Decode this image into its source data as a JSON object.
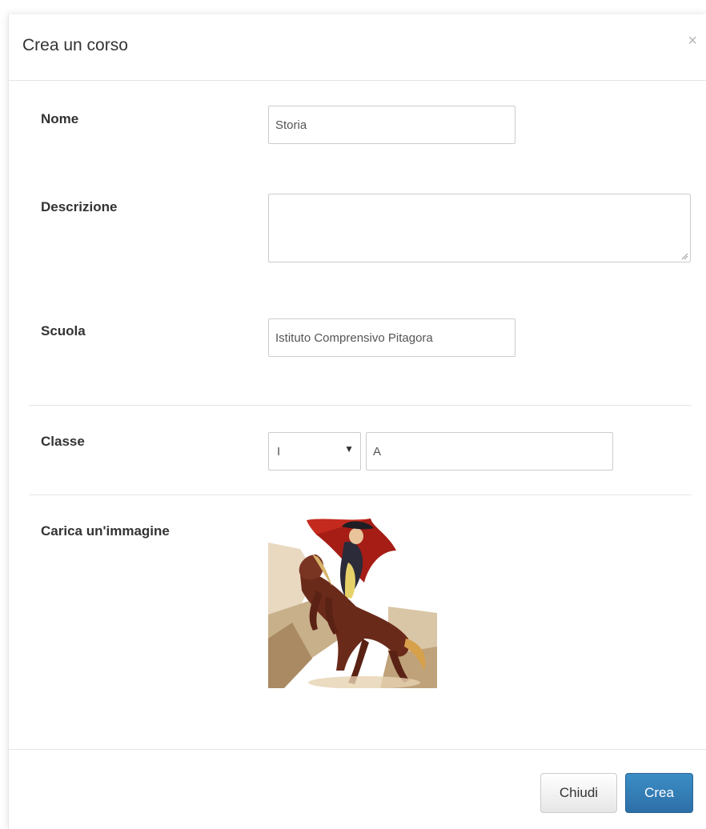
{
  "modal": {
    "title": "Crea un corso",
    "close_symbol": "×"
  },
  "form": {
    "nome": {
      "label": "Nome",
      "value": "Storia"
    },
    "descrizione": {
      "label": "Descrizione",
      "value": ""
    },
    "scuola": {
      "label": "Scuola",
      "value": "Istituto Comprensivo Pitagora"
    },
    "classe": {
      "label": "Classe",
      "select_value": "I",
      "section_value": "A"
    },
    "immagine": {
      "label": "Carica un'immagine",
      "image_alt": "painting-of-rider-on-rearing-horse"
    }
  },
  "footer": {
    "close_label": "Chiudi",
    "create_label": "Crea"
  },
  "colors": {
    "primary": "#337ab7",
    "border": "#cccccc",
    "text": "#333333"
  },
  "icons": {
    "close": "close-icon",
    "caret": "chevron-down-icon",
    "resize": "resize-handle-icon"
  }
}
